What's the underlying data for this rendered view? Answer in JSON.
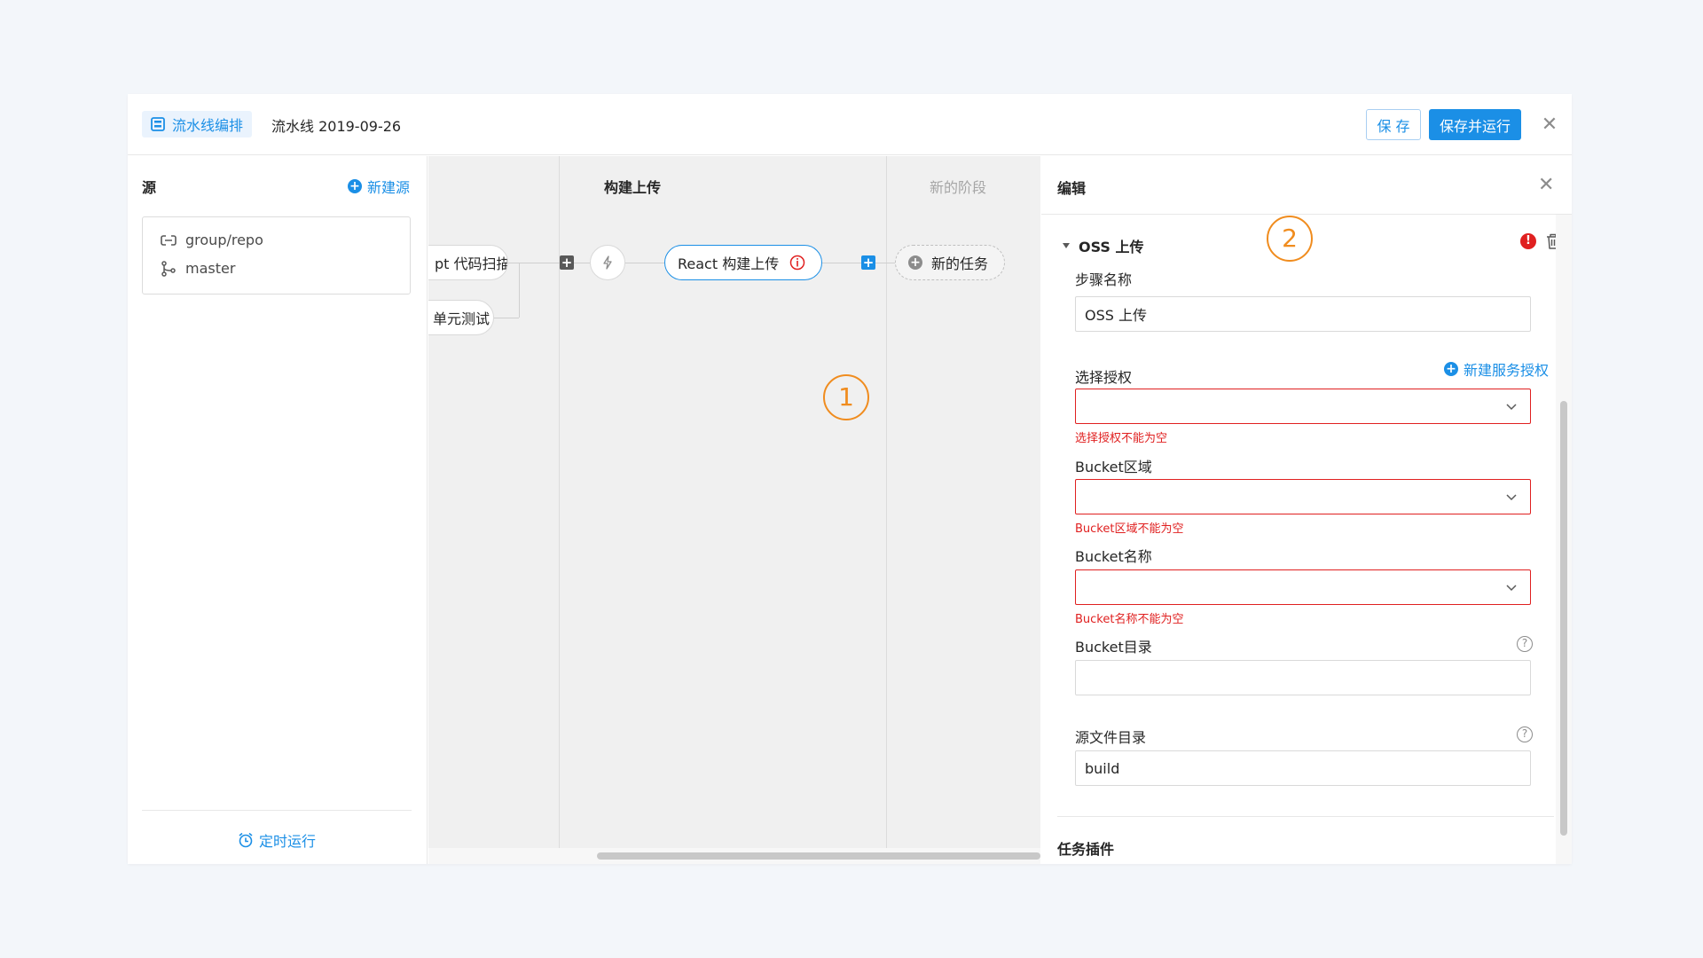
{
  "topbar": {
    "app_label": "流水线编排",
    "pipeline_name": "流水线 2019-09-26",
    "save_label": "保 存",
    "save_run_label": "保存并运行"
  },
  "sources": {
    "title": "源",
    "new_source_label": "新建源",
    "repo": "group/repo",
    "branch": "master",
    "schedule_label": "定时运行"
  },
  "canvas": {
    "stages": [
      {
        "title": "构建上传"
      },
      {
        "title": "新的阶段"
      }
    ],
    "nodes": {
      "code_scan": "pt 代码扫描",
      "unit_test": "单元测试",
      "react_build": "React 构建上传",
      "new_task": "新的任务"
    }
  },
  "callouts": [
    "1",
    "2"
  ],
  "editor": {
    "title": "编辑",
    "section_title": "OSS 上传",
    "step_name_label": "步骤名称",
    "step_name_value": "OSS 上传",
    "auth_label": "选择授权",
    "new_auth_label": "新建服务授权",
    "auth_error": "选择授权不能为空",
    "region_label": "Bucket区域",
    "region_error": "Bucket区域不能为空",
    "bucket_label": "Bucket名称",
    "bucket_error": "Bucket名称不能为空",
    "bucket_dir_label": "Bucket目录",
    "bucket_dir_value": "",
    "src_dir_label": "源文件目录",
    "src_dir_value": "build",
    "plugins_label": "任务插件"
  },
  "colors": {
    "primary": "#1b8fe6",
    "error": "#e02020",
    "callout": "#f08c1e"
  }
}
